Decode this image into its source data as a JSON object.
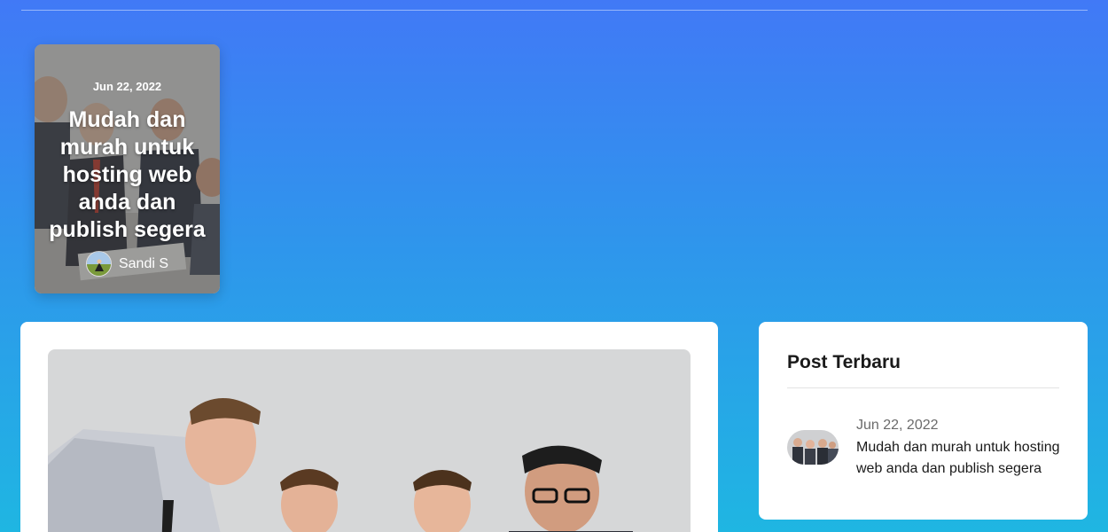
{
  "featured": {
    "date": "Jun 22, 2022",
    "title": "Mudah dan murah untuk hosting web anda dan publish segera",
    "author": "Sandi S"
  },
  "sidebar": {
    "title": "Post Terbaru",
    "posts": [
      {
        "date": "Jun 22, 2022",
        "title": "Mudah dan murah untuk hosting web anda dan publish segera"
      }
    ]
  }
}
